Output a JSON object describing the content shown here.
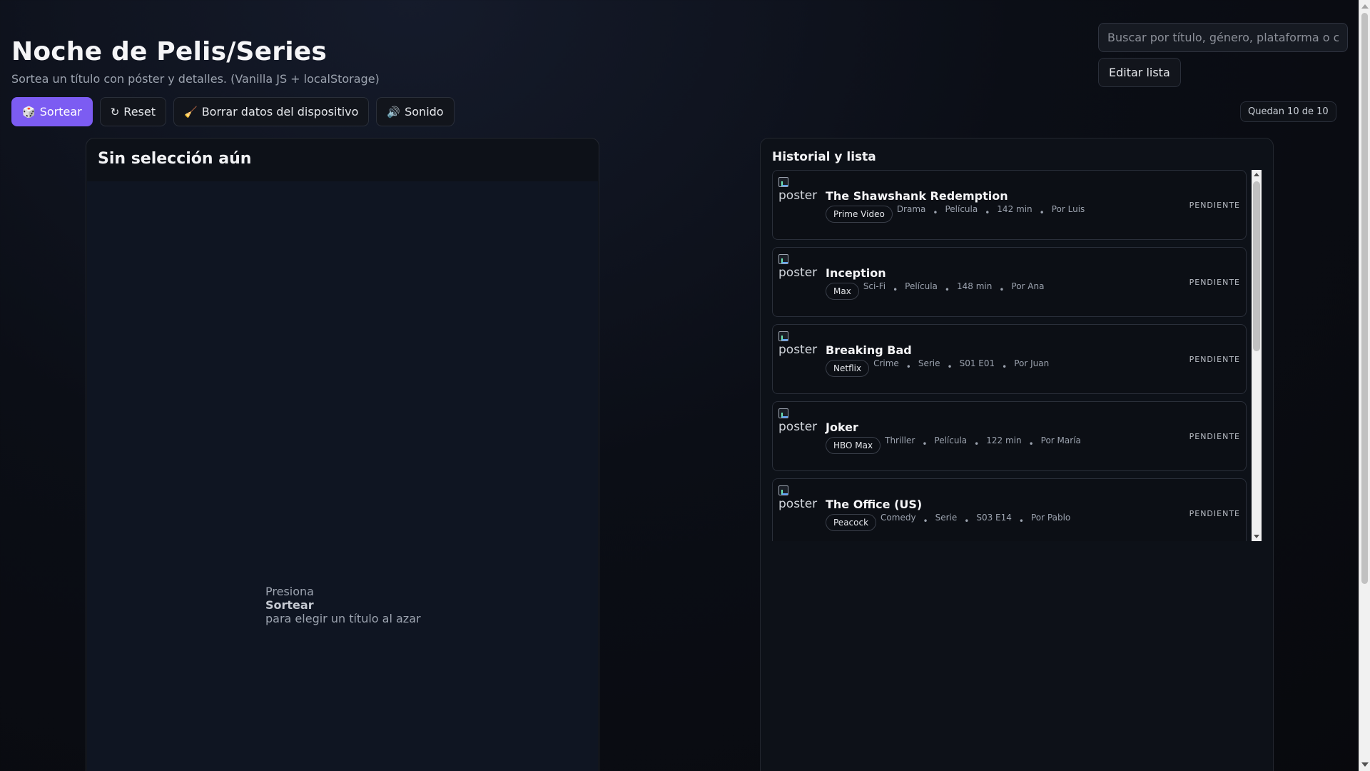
{
  "header": {
    "title": "Noche de Pelis/Series",
    "subtitle": "Sortea un título con póster y detalles. (Vanilla JS + localStorage)"
  },
  "toolbar": {
    "sortear": {
      "icon": "🎲",
      "label": "Sortear"
    },
    "reset": {
      "icon": "↻",
      "label": "Reset"
    },
    "clear": {
      "icon": "🧹",
      "label": "Borrar datos del dispositivo"
    },
    "sound": {
      "icon": "🔊",
      "label": "Sonido"
    }
  },
  "search": {
    "placeholder": "Buscar por título, género, plataforma o c"
  },
  "edit_list_label": "Editar lista",
  "remaining": "Quedan 10 de 10",
  "selection": {
    "title": "Sin selección aún",
    "empty_line1": "Presiona",
    "empty_bold": "Sortear",
    "empty_line2": "para elegir un título al azar"
  },
  "history": {
    "title": "Historial y lista",
    "poster_alt": "poster",
    "items": [
      {
        "title": "The Shawshank Redemption",
        "platform": "Prime Video",
        "genre": "Drama",
        "type": "Película",
        "length": "142 min",
        "by": "Por Luis",
        "status": "PENDIENTE"
      },
      {
        "title": "Inception",
        "platform": "Max",
        "genre": "Sci-Fi",
        "type": "Película",
        "length": "148 min",
        "by": "Por Ana",
        "status": "PENDIENTE"
      },
      {
        "title": "Breaking Bad",
        "platform": "Netflix",
        "genre": "Crime",
        "type": "Serie",
        "length": "S01 E01",
        "by": "Por Juan",
        "status": "PENDIENTE"
      },
      {
        "title": "Joker",
        "platform": "HBO Max",
        "genre": "Thriller",
        "type": "Película",
        "length": "122 min",
        "by": "Por María",
        "status": "PENDIENTE"
      },
      {
        "title": "The Office (US)",
        "platform": "Peacock",
        "genre": "Comedy",
        "type": "Serie",
        "length": "S03 E14",
        "by": "Por Pablo",
        "status": "PENDIENTE"
      }
    ]
  },
  "colors": {
    "accent": "#7c5cf2"
  }
}
